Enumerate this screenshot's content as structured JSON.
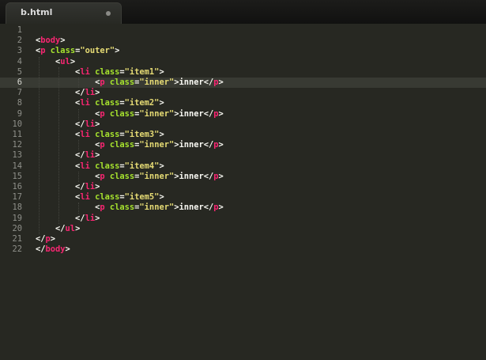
{
  "tab": {
    "title": "b.html"
  },
  "editor": {
    "current_line": 6,
    "lines": [
      {
        "num": "1",
        "tokens": []
      },
      {
        "num": "2",
        "tokens": [
          {
            "t": "punc",
            "v": "<"
          },
          {
            "t": "tag",
            "v": "body"
          },
          {
            "t": "punc",
            "v": ">"
          }
        ]
      },
      {
        "num": "3",
        "tokens": [
          {
            "t": "punc",
            "v": "<"
          },
          {
            "t": "tag",
            "v": "p"
          },
          {
            "t": "text",
            "v": " "
          },
          {
            "t": "attr",
            "v": "class"
          },
          {
            "t": "punc",
            "v": "="
          },
          {
            "t": "str",
            "v": "\"outer\""
          },
          {
            "t": "punc",
            "v": ">"
          }
        ]
      },
      {
        "num": "4",
        "tokens": [
          {
            "t": "text",
            "v": "    "
          },
          {
            "t": "punc",
            "v": "<"
          },
          {
            "t": "tag",
            "v": "ul"
          },
          {
            "t": "punc",
            "v": ">"
          }
        ]
      },
      {
        "num": "5",
        "tokens": [
          {
            "t": "text",
            "v": "        "
          },
          {
            "t": "punc",
            "v": "<"
          },
          {
            "t": "tag",
            "v": "li"
          },
          {
            "t": "text",
            "v": " "
          },
          {
            "t": "attr",
            "v": "class"
          },
          {
            "t": "punc",
            "v": "="
          },
          {
            "t": "str",
            "v": "\"item1\""
          },
          {
            "t": "punc",
            "v": ">"
          }
        ]
      },
      {
        "num": "6",
        "tokens": [
          {
            "t": "text",
            "v": "            "
          },
          {
            "t": "punc",
            "v": "<"
          },
          {
            "t": "tag",
            "v": "p"
          },
          {
            "t": "text",
            "v": " "
          },
          {
            "t": "attr",
            "v": "class"
          },
          {
            "t": "punc",
            "v": "="
          },
          {
            "t": "str",
            "v": "\"inner\""
          },
          {
            "t": "punc",
            "v": ">"
          },
          {
            "t": "text",
            "v": "inner"
          },
          {
            "t": "punc",
            "v": "</"
          },
          {
            "t": "tag",
            "v": "p"
          },
          {
            "t": "punc",
            "v": ">"
          }
        ]
      },
      {
        "num": "7",
        "tokens": [
          {
            "t": "text",
            "v": "        "
          },
          {
            "t": "punc",
            "v": "</"
          },
          {
            "t": "tag",
            "v": "li"
          },
          {
            "t": "punc",
            "v": ">"
          }
        ]
      },
      {
        "num": "8",
        "tokens": [
          {
            "t": "text",
            "v": "        "
          },
          {
            "t": "punc",
            "v": "<"
          },
          {
            "t": "tag",
            "v": "li"
          },
          {
            "t": "text",
            "v": " "
          },
          {
            "t": "attr",
            "v": "class"
          },
          {
            "t": "punc",
            "v": "="
          },
          {
            "t": "str",
            "v": "\"item2\""
          },
          {
            "t": "punc",
            "v": ">"
          }
        ]
      },
      {
        "num": "9",
        "tokens": [
          {
            "t": "text",
            "v": "            "
          },
          {
            "t": "punc",
            "v": "<"
          },
          {
            "t": "tag",
            "v": "p"
          },
          {
            "t": "text",
            "v": " "
          },
          {
            "t": "attr",
            "v": "class"
          },
          {
            "t": "punc",
            "v": "="
          },
          {
            "t": "str",
            "v": "\"inner\""
          },
          {
            "t": "punc",
            "v": ">"
          },
          {
            "t": "text",
            "v": "inner"
          },
          {
            "t": "punc",
            "v": "</"
          },
          {
            "t": "tag",
            "v": "p"
          },
          {
            "t": "punc",
            "v": ">"
          }
        ]
      },
      {
        "num": "10",
        "tokens": [
          {
            "t": "text",
            "v": "        "
          },
          {
            "t": "punc",
            "v": "</"
          },
          {
            "t": "tag",
            "v": "li"
          },
          {
            "t": "punc",
            "v": ">"
          }
        ]
      },
      {
        "num": "11",
        "tokens": [
          {
            "t": "text",
            "v": "        "
          },
          {
            "t": "punc",
            "v": "<"
          },
          {
            "t": "tag",
            "v": "li"
          },
          {
            "t": "text",
            "v": " "
          },
          {
            "t": "attr",
            "v": "class"
          },
          {
            "t": "punc",
            "v": "="
          },
          {
            "t": "str",
            "v": "\"item3\""
          },
          {
            "t": "punc",
            "v": ">"
          }
        ]
      },
      {
        "num": "12",
        "tokens": [
          {
            "t": "text",
            "v": "            "
          },
          {
            "t": "punc",
            "v": "<"
          },
          {
            "t": "tag",
            "v": "p"
          },
          {
            "t": "text",
            "v": " "
          },
          {
            "t": "attr",
            "v": "class"
          },
          {
            "t": "punc",
            "v": "="
          },
          {
            "t": "str",
            "v": "\"inner\""
          },
          {
            "t": "punc",
            "v": ">"
          },
          {
            "t": "text",
            "v": "inner"
          },
          {
            "t": "punc",
            "v": "</"
          },
          {
            "t": "tag",
            "v": "p"
          },
          {
            "t": "punc",
            "v": ">"
          }
        ]
      },
      {
        "num": "13",
        "tokens": [
          {
            "t": "text",
            "v": "        "
          },
          {
            "t": "punc",
            "v": "</"
          },
          {
            "t": "tag",
            "v": "li"
          },
          {
            "t": "punc",
            "v": ">"
          }
        ]
      },
      {
        "num": "14",
        "tokens": [
          {
            "t": "text",
            "v": "        "
          },
          {
            "t": "punc",
            "v": "<"
          },
          {
            "t": "tag",
            "v": "li"
          },
          {
            "t": "text",
            "v": " "
          },
          {
            "t": "attr",
            "v": "class"
          },
          {
            "t": "punc",
            "v": "="
          },
          {
            "t": "str",
            "v": "\"item4\""
          },
          {
            "t": "punc",
            "v": ">"
          }
        ]
      },
      {
        "num": "15",
        "tokens": [
          {
            "t": "text",
            "v": "            "
          },
          {
            "t": "punc",
            "v": "<"
          },
          {
            "t": "tag",
            "v": "p"
          },
          {
            "t": "text",
            "v": " "
          },
          {
            "t": "attr",
            "v": "class"
          },
          {
            "t": "punc",
            "v": "="
          },
          {
            "t": "str",
            "v": "\"inner\""
          },
          {
            "t": "punc",
            "v": ">"
          },
          {
            "t": "text",
            "v": "inner"
          },
          {
            "t": "punc",
            "v": "</"
          },
          {
            "t": "tag",
            "v": "p"
          },
          {
            "t": "punc",
            "v": ">"
          }
        ]
      },
      {
        "num": "16",
        "tokens": [
          {
            "t": "text",
            "v": "        "
          },
          {
            "t": "punc",
            "v": "</"
          },
          {
            "t": "tag",
            "v": "li"
          },
          {
            "t": "punc",
            "v": ">"
          }
        ]
      },
      {
        "num": "17",
        "tokens": [
          {
            "t": "text",
            "v": "        "
          },
          {
            "t": "punc",
            "v": "<"
          },
          {
            "t": "tag",
            "v": "li"
          },
          {
            "t": "text",
            "v": " "
          },
          {
            "t": "attr",
            "v": "class"
          },
          {
            "t": "punc",
            "v": "="
          },
          {
            "t": "str",
            "v": "\"item5\""
          },
          {
            "t": "punc",
            "v": ">"
          }
        ]
      },
      {
        "num": "18",
        "tokens": [
          {
            "t": "text",
            "v": "            "
          },
          {
            "t": "punc",
            "v": "<"
          },
          {
            "t": "tag",
            "v": "p"
          },
          {
            "t": "text",
            "v": " "
          },
          {
            "t": "attr",
            "v": "class"
          },
          {
            "t": "punc",
            "v": "="
          },
          {
            "t": "str",
            "v": "\"inner\""
          },
          {
            "t": "punc",
            "v": ">"
          },
          {
            "t": "text",
            "v": "inner"
          },
          {
            "t": "punc",
            "v": "</"
          },
          {
            "t": "tag",
            "v": "p"
          },
          {
            "t": "punc",
            "v": ">"
          }
        ]
      },
      {
        "num": "19",
        "tokens": [
          {
            "t": "text",
            "v": "        "
          },
          {
            "t": "punc",
            "v": "</"
          },
          {
            "t": "tag",
            "v": "li"
          },
          {
            "t": "punc",
            "v": ">"
          }
        ]
      },
      {
        "num": "20",
        "tokens": [
          {
            "t": "text",
            "v": "    "
          },
          {
            "t": "punc",
            "v": "</"
          },
          {
            "t": "tag",
            "v": "ul"
          },
          {
            "t": "punc",
            "v": ">"
          }
        ]
      },
      {
        "num": "21",
        "tokens": [
          {
            "t": "punc",
            "v": "</"
          },
          {
            "t": "tag",
            "v": "p"
          },
          {
            "t": "punc",
            "v": ">"
          }
        ]
      },
      {
        "num": "22",
        "tokens": [
          {
            "t": "punc",
            "v": "</"
          },
          {
            "t": "tag",
            "v": "body"
          },
          {
            "t": "punc",
            "v": ">"
          }
        ]
      }
    ]
  },
  "colors": {
    "background": "#272822",
    "tag": "#f92672",
    "attribute": "#a6e22e",
    "string": "#e6db74",
    "text": "#f8f8f2",
    "gutter": "#8f908a"
  }
}
